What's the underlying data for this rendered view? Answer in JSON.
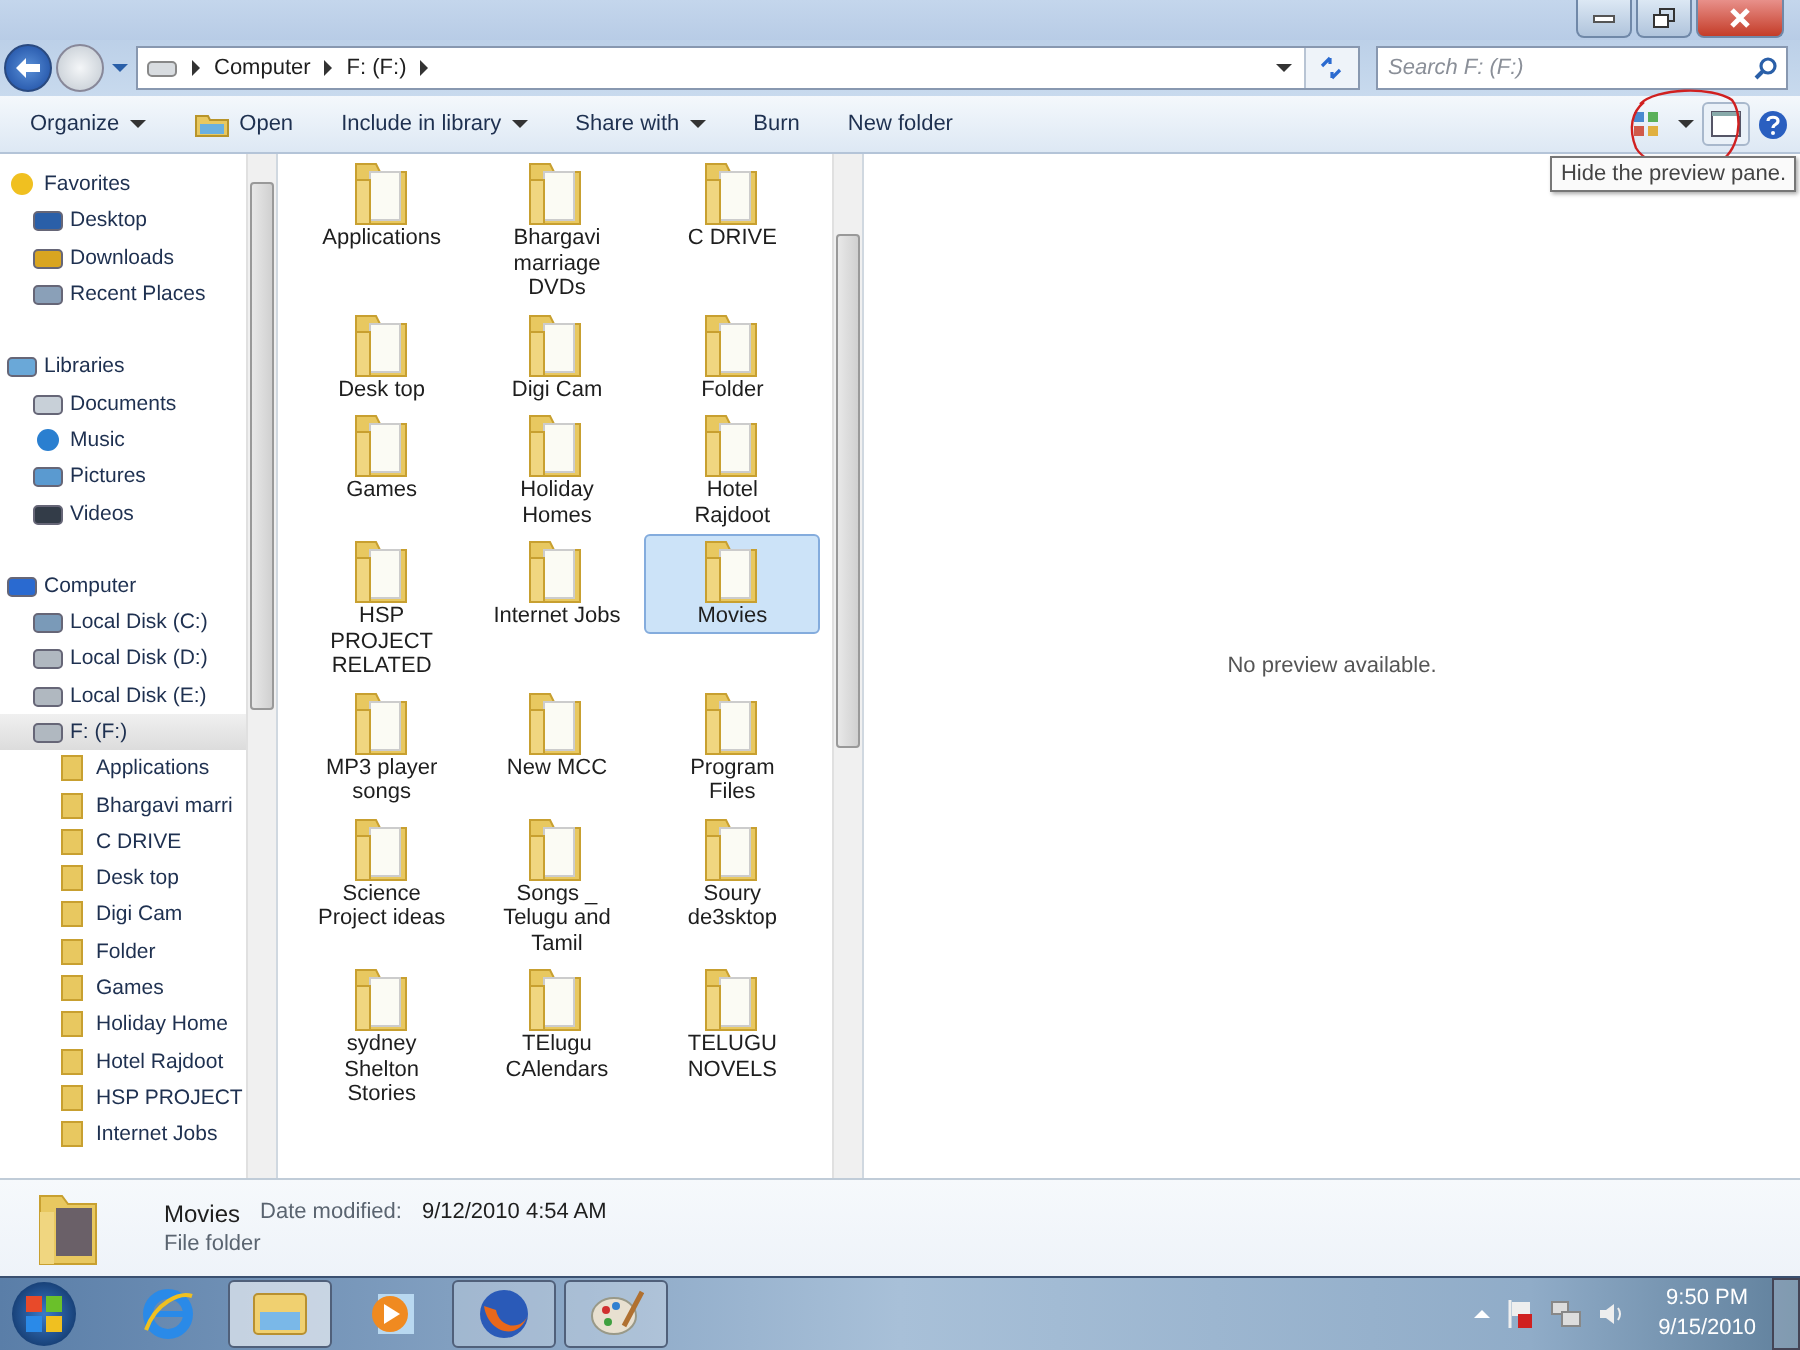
{
  "address": {
    "crumbs": [
      "Computer",
      "F: (F:)"
    ]
  },
  "search": {
    "placeholder": "Search F: (F:)"
  },
  "toolbar": {
    "buttons": [
      {
        "label": "Organize",
        "kind": "menu"
      },
      {
        "label": "Open",
        "kind": "open"
      },
      {
        "label": "Include in library",
        "kind": "menu"
      },
      {
        "label": "Share with",
        "kind": "menu"
      },
      {
        "label": "Burn",
        "kind": "plain"
      },
      {
        "label": "New folder",
        "kind": "plain"
      }
    ],
    "tooltip": "Hide the preview pane."
  },
  "nav": [
    {
      "label": "Favorites",
      "kind": "star",
      "selected": false,
      "children": [
        {
          "label": "Desktop",
          "kind": "desktop",
          "selected": false
        },
        {
          "label": "Downloads",
          "kind": "download",
          "selected": false
        },
        {
          "label": "Recent Places",
          "kind": "recent",
          "selected": false
        }
      ]
    },
    {
      "label": "Libraries",
      "kind": "library",
      "selected": false,
      "children": [
        {
          "label": "Documents",
          "kind": "document",
          "selected": false
        },
        {
          "label": "Music",
          "kind": "music",
          "selected": false
        },
        {
          "label": "Pictures",
          "kind": "picture",
          "selected": false
        },
        {
          "label": "Videos",
          "kind": "video",
          "selected": false
        }
      ]
    },
    {
      "label": "Computer",
      "kind": "computer",
      "selected": false,
      "children": [
        {
          "label": "Local Disk (C:)",
          "kind": "sysdisk",
          "selected": false
        },
        {
          "label": "Local Disk (D:)",
          "kind": "disk",
          "selected": false
        },
        {
          "label": "Local Disk (E:)",
          "kind": "disk",
          "selected": false
        },
        {
          "label": "F: (F:)",
          "kind": "disk",
          "selected": true,
          "children": [
            {
              "label": "Applications",
              "kind": "folder",
              "selected": false
            },
            {
              "label": "Bhargavi marri",
              "kind": "folder",
              "selected": false
            },
            {
              "label": "C DRIVE",
              "kind": "folder",
              "selected": false
            },
            {
              "label": "Desk top",
              "kind": "folder",
              "selected": false
            },
            {
              "label": "Digi Cam",
              "kind": "folder",
              "selected": false
            },
            {
              "label": "Folder",
              "kind": "folder",
              "selected": false
            },
            {
              "label": "Games",
              "kind": "folder",
              "selected": false
            },
            {
              "label": "Holiday Home",
              "kind": "folder",
              "selected": false
            },
            {
              "label": "Hotel Rajdoot",
              "kind": "folder",
              "selected": false
            },
            {
              "label": "HSP PROJECT",
              "kind": "folder",
              "selected": false
            },
            {
              "label": "Internet Jobs",
              "kind": "folder",
              "selected": false
            }
          ]
        }
      ]
    }
  ],
  "files": [
    {
      "name": "Applications",
      "selected": false
    },
    {
      "name": "Bhargavi marriage DVDs",
      "selected": false
    },
    {
      "name": "C DRIVE",
      "selected": false
    },
    {
      "name": "Desk top",
      "selected": false
    },
    {
      "name": "Digi Cam",
      "selected": false
    },
    {
      "name": "Folder",
      "selected": false
    },
    {
      "name": "Games",
      "selected": false
    },
    {
      "name": "Holiday Homes",
      "selected": false
    },
    {
      "name": "Hotel Rajdoot",
      "selected": false
    },
    {
      "name": "HSP PROJECT RELATED",
      "selected": false
    },
    {
      "name": "Internet Jobs",
      "selected": false
    },
    {
      "name": "Movies",
      "selected": true
    },
    {
      "name": "MP3 player songs",
      "selected": false
    },
    {
      "name": "New MCC",
      "selected": false
    },
    {
      "name": "Program Files",
      "selected": false
    },
    {
      "name": "Science Project ideas",
      "selected": false
    },
    {
      "name": "Songs _ Telugu and Tamil",
      "selected": false
    },
    {
      "name": "Soury de3sktop",
      "selected": false
    },
    {
      "name": "sydney Shelton Stories",
      "selected": false
    },
    {
      "name": "TElugu CAlendars",
      "selected": false
    },
    {
      "name": "TELUGU NOVELS",
      "selected": false
    }
  ],
  "preview": {
    "message": "No preview available."
  },
  "details": {
    "name": "Movies",
    "date_label": "Date modified:",
    "date": "9/12/2010 4:54 AM",
    "type": "File folder"
  },
  "taskbar": {
    "apps": [
      {
        "kind": "ie",
        "running": false,
        "selected": false
      },
      {
        "kind": "explorer",
        "running": true,
        "selected": true
      },
      {
        "kind": "media",
        "running": false,
        "selected": false
      },
      {
        "kind": "firefox",
        "running": true,
        "selected": false
      },
      {
        "kind": "paint",
        "running": true,
        "selected": false
      }
    ],
    "time": "9:50 PM",
    "date": "9/15/2010"
  }
}
